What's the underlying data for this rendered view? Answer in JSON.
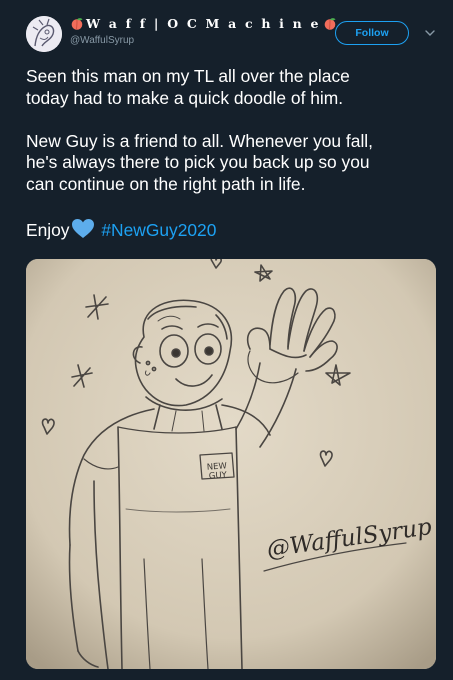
{
  "author": {
    "display_name": "W a f f | O C  M a c h i n e",
    "handle": "@WaffulSyrup",
    "avatar_icon": "avatar-sketch-icon",
    "name_icon": "peach-icon"
  },
  "actions": {
    "follow_label": "Follow",
    "more_icon": "chevron-down-icon"
  },
  "tweet": {
    "lines": [
      "Seen this man on my TL all over the place",
      "today had to make a quick doodle of him.",
      "New Guy is a friend to all. Whenever you fall,",
      "he's always there to pick you back up so you",
      "can continue on the right path in life."
    ],
    "enjoy": "Enjoy",
    "heart_icon": "blue-heart-icon",
    "hashtag": "#NewGuy2020"
  },
  "media": {
    "name_tag_line1": "NEW",
    "name_tag_line2": "GUY",
    "signature": "@WaffulSyrup"
  },
  "colors": {
    "background": "#15202b",
    "accent": "#1da1f2",
    "secondary_text": "#8899a6",
    "paper": "#d6ccb9"
  }
}
